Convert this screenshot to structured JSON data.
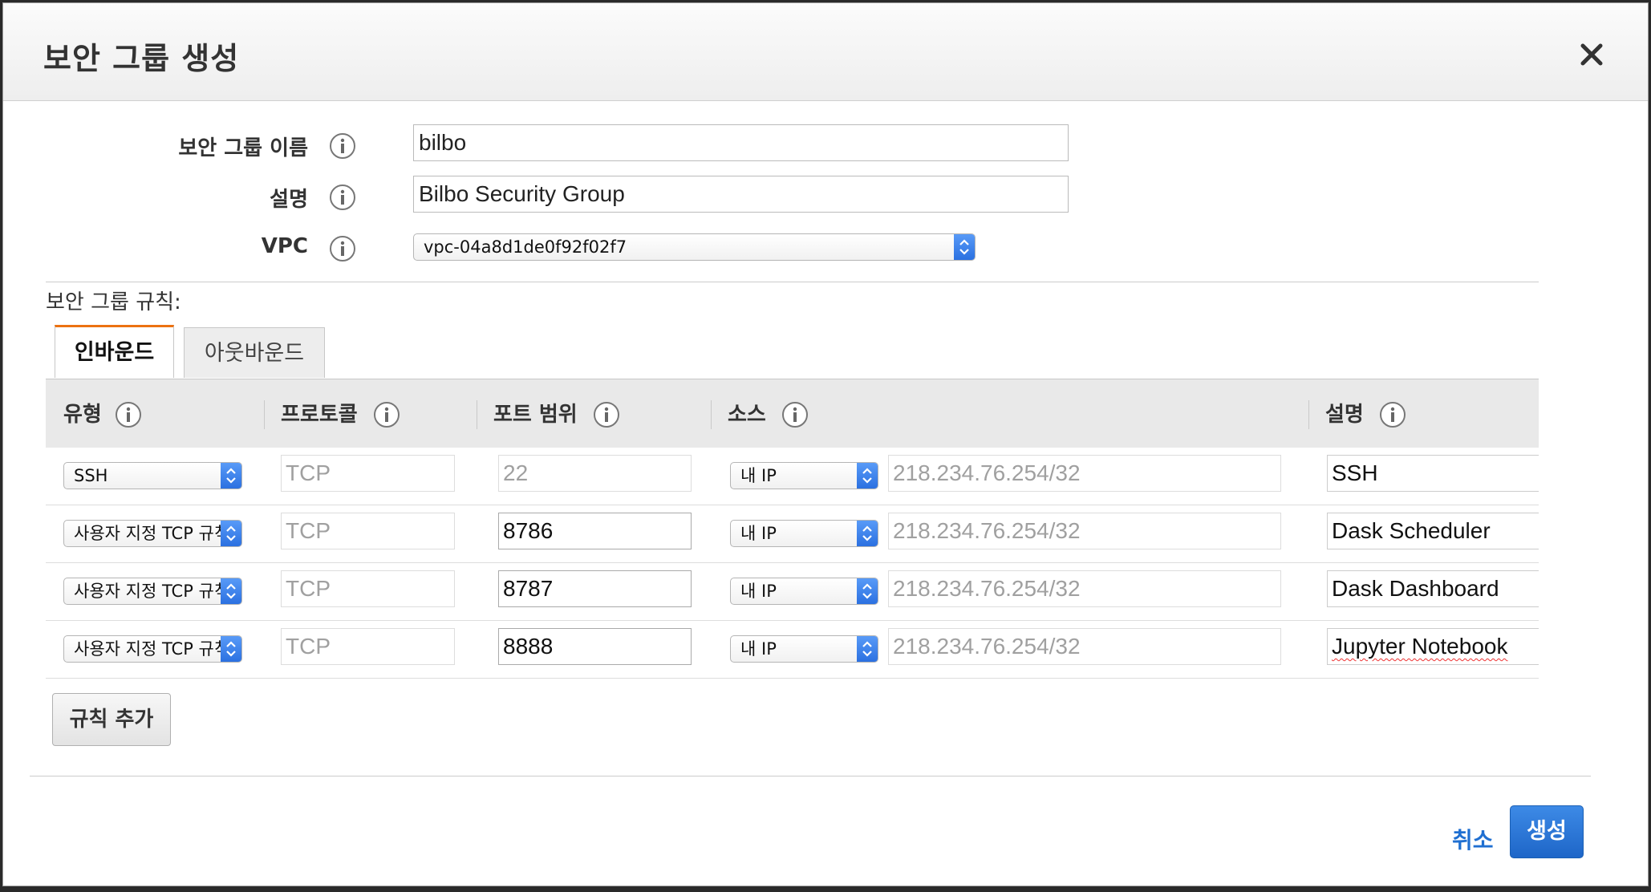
{
  "dialog": {
    "title": "보안 그룹 생성",
    "close_icon": "close-icon"
  },
  "form": {
    "name_label": "보안 그룹 이름",
    "name_value": "bilbo",
    "description_label": "설명",
    "description_value": "Bilbo Security Group",
    "vpc_label": "VPC",
    "vpc_value": "vpc-04a8d1de0f92f02f7",
    "info_icon": "info-icon"
  },
  "rules": {
    "section_label": "보안 그룹 규칙:",
    "tabs": [
      {
        "label": "인바운드",
        "active": true
      },
      {
        "label": "아웃바운드",
        "active": false
      }
    ],
    "columns": {
      "type": "유형",
      "protocol": "프로토콜",
      "port_range": "포트 범위",
      "source": "소스",
      "description": "설명"
    },
    "rows": [
      {
        "type": "SSH",
        "protocol": "TCP",
        "port": "22",
        "source": "내 IP",
        "cidr": "218.234.76.254/32",
        "description": "SSH"
      },
      {
        "type": "사용자 지정 TCP 규칙",
        "protocol": "TCP",
        "port": "8786",
        "source": "내 IP",
        "cidr": "218.234.76.254/32",
        "description": "Dask Scheduler"
      },
      {
        "type": "사용자 지정 TCP 규칙",
        "protocol": "TCP",
        "port": "8787",
        "source": "내 IP",
        "cidr": "218.234.76.254/32",
        "description": "Dask Dashboard"
      },
      {
        "type": "사용자 지정 TCP 규칙",
        "protocol": "TCP",
        "port": "8888",
        "source": "내 IP",
        "cidr": "218.234.76.254/32",
        "description": "Jupyter Notebook"
      }
    ],
    "add_rule_label": "규칙 추가"
  },
  "footer": {
    "cancel_label": "취소",
    "create_label": "생성"
  },
  "colors": {
    "accent_tab": "#ec7211",
    "primary_button": "#1e66c8",
    "link": "#1f6fd1"
  }
}
